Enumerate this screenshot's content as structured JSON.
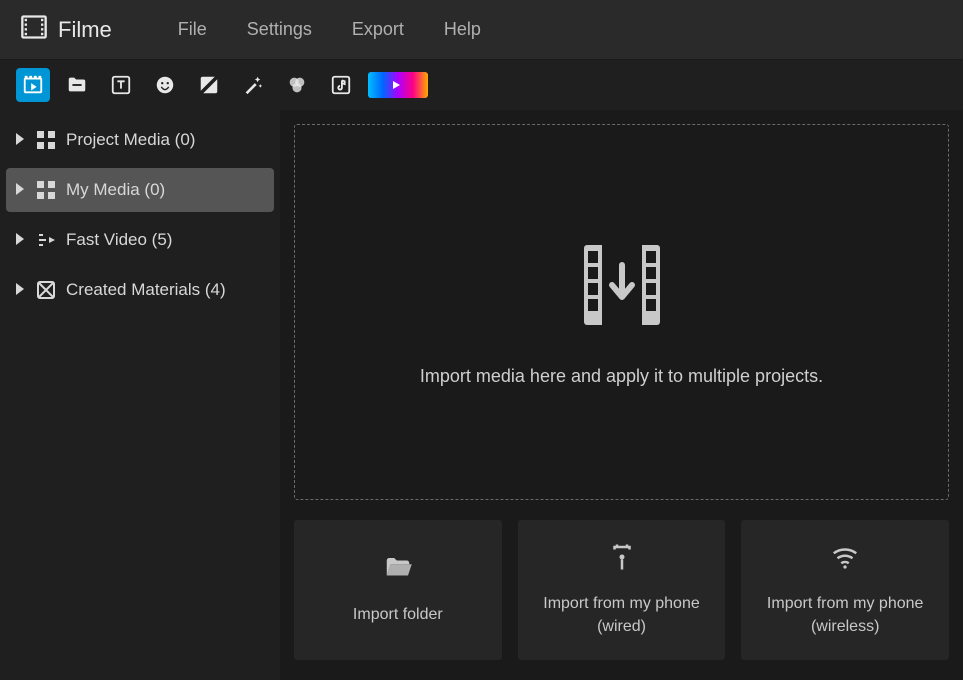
{
  "app": {
    "title": "Filme"
  },
  "menu": {
    "file": "File",
    "settings": "Settings",
    "export": "Export",
    "help": "Help"
  },
  "sidebar": {
    "items": [
      {
        "label": "Project Media (0)"
      },
      {
        "label": "My Media (0)"
      },
      {
        "label": "Fast Video (5)"
      },
      {
        "label": "Created Materials (4)"
      }
    ]
  },
  "dropzone": {
    "text": "Import media here and apply it to multiple projects."
  },
  "import_cards": {
    "folder": "Import folder",
    "phone_wired": "Import from my phone (wired)",
    "phone_wireless": "Import from my phone (wireless)"
  }
}
